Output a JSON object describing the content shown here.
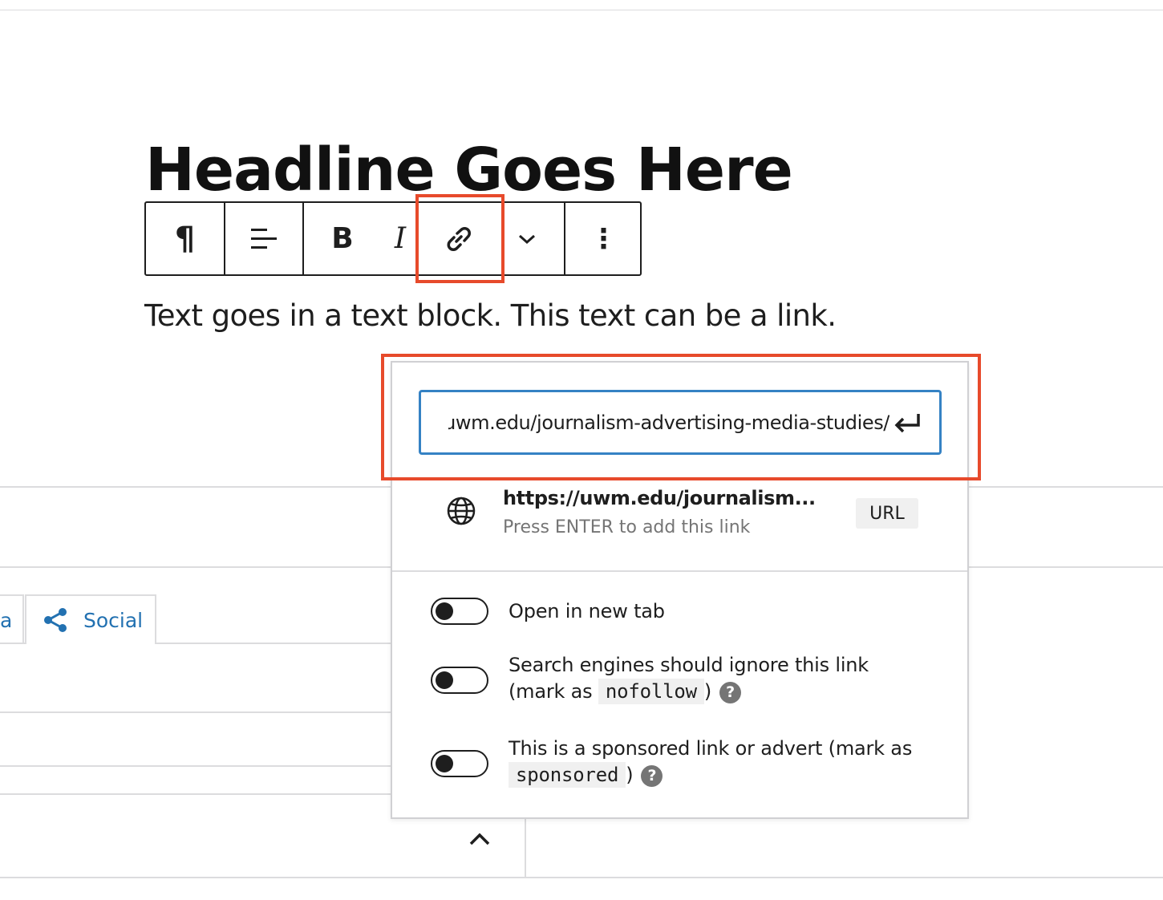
{
  "editor": {
    "headline": "Headline Goes Here",
    "paragraph": "Text goes in a text block. This text can be a link."
  },
  "toolbar": {
    "paragraph_glyph": "¶",
    "bold_label": "B",
    "italic_label": "I",
    "more_glyph": "⋮"
  },
  "tabs": {
    "partial_label": "a",
    "social_label": "Social"
  },
  "link_popover": {
    "url_value": "https://uwm.edu/journalism-advertising-media-studies/",
    "suggestion": {
      "title": "https://uwm.edu/journalism...",
      "hint": "Press ENTER to add this link",
      "badge": "URL"
    },
    "options": [
      {
        "text": "Open in new tab",
        "checked": false
      },
      {
        "text_before": "Search engines should ignore this link",
        "text_line2": "(mark as",
        "code": "nofollow",
        "text_after": ")",
        "checked": false
      },
      {
        "text_before": "This is a sponsored link or advert (mark as",
        "code": "sponsored",
        "text_after": ")",
        "checked": false
      }
    ],
    "help_glyph": "?"
  },
  "colors": {
    "highlight": "#e74a2b",
    "input_border": "#3582c4",
    "link_blue": "#2271b1"
  },
  "icons": [
    "paragraph-icon",
    "align-left-icon",
    "bold-icon",
    "italic-icon",
    "link-icon",
    "chevron-down-icon",
    "more-options-icon",
    "share-icon",
    "chevron-up-icon",
    "enter-icon",
    "globe-icon",
    "help-icon"
  ]
}
